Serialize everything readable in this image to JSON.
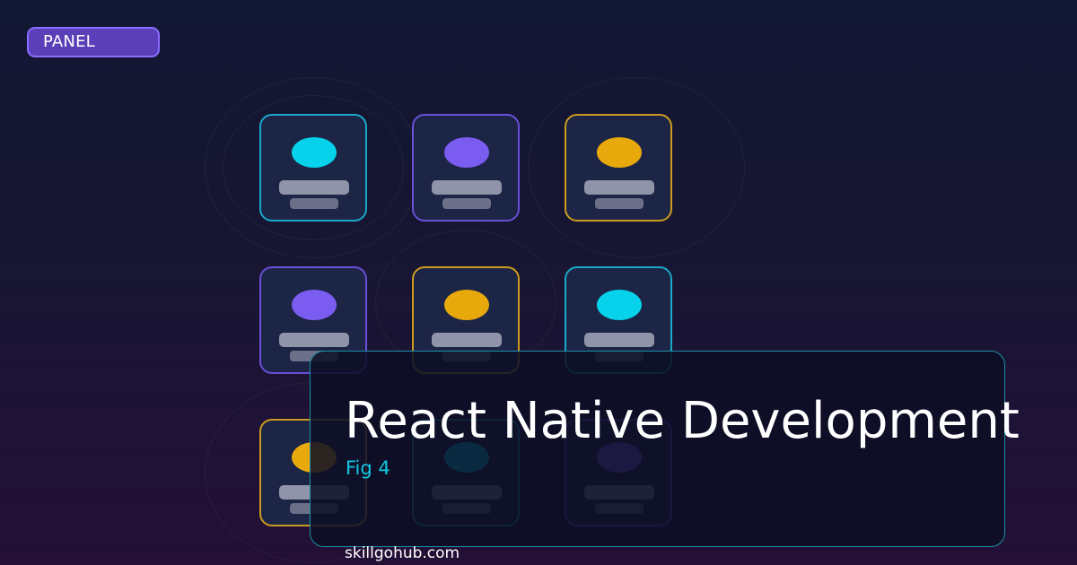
{
  "badge": {
    "label": "PANEL"
  },
  "colors": {
    "cyan": "#06d2ec",
    "purple": "#7b5cf0",
    "gold": "#e8a90c",
    "cyan_border": "#1aa8c8",
    "purple_border": "#6a4fd8",
    "gold_border": "#cc9a1e"
  },
  "tiles": [
    {
      "accent": "cyan"
    },
    {
      "accent": "purple"
    },
    {
      "accent": "gold"
    },
    {
      "accent": "purple"
    },
    {
      "accent": "gold"
    },
    {
      "accent": "cyan"
    },
    {
      "accent": "gold"
    },
    {
      "accent": "cyan"
    },
    {
      "accent": "purple"
    }
  ],
  "overlay": {
    "title": "React Native Development",
    "subtitle": "Fig 4"
  },
  "footer": {
    "site": "skillgohub.com"
  }
}
